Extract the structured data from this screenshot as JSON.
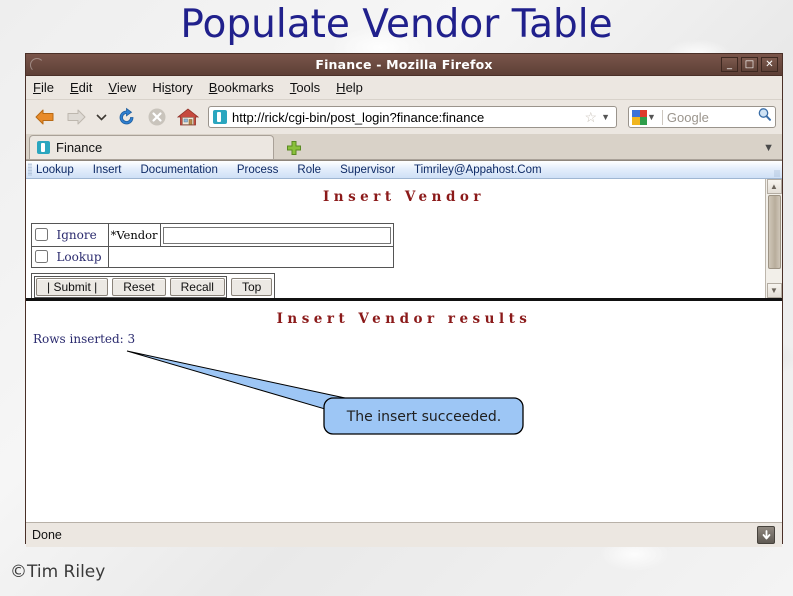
{
  "slide": {
    "title": "Populate Vendor Table",
    "footer": "©Tim Riley",
    "title_color": "#20208c"
  },
  "browser": {
    "window_title": "Finance - Mozilla Firefox",
    "window_controls": {
      "minimize": "_",
      "maximize": "□",
      "close": "✕"
    },
    "menus": [
      {
        "label": "File",
        "accel": "F"
      },
      {
        "label": "Edit",
        "accel": "E"
      },
      {
        "label": "View",
        "accel": "V"
      },
      {
        "label": "History",
        "accel": "s"
      },
      {
        "label": "Bookmarks",
        "accel": "B"
      },
      {
        "label": "Tools",
        "accel": "T"
      },
      {
        "label": "Help",
        "accel": "H"
      }
    ],
    "toolbar": {
      "back_icon": "back-arrow-icon",
      "forward_icon": "forward-arrow-icon",
      "history_dropdown_icon": "chevron-down-icon",
      "reload_icon": "reload-icon",
      "stop_icon": "stop-icon",
      "home_icon": "home-icon",
      "url": "http://rick/cgi-bin/post_login?finance:finance",
      "bookmark_star_icon": "star-icon",
      "url_dropdown_icon": "chevron-down-icon"
    },
    "search": {
      "engine_icon": "google-icon",
      "engine_dropdown_icon": "chevron-down-icon",
      "placeholder": "Google",
      "submit_icon": "magnifier-icon"
    },
    "tabs": [
      {
        "label": "Finance",
        "favicon": "page-favicon-icon",
        "active": true
      }
    ],
    "new_tab_icon": "plus-icon",
    "tab_list_icon": "chevron-down-icon",
    "status": {
      "text": "Done",
      "downloads_icon": "download-arrow-icon"
    }
  },
  "app": {
    "nav_items": [
      "Lookup",
      "Insert",
      "Documentation",
      "Process",
      "Role",
      "Supervisor",
      "Timriley@Appahost.Com"
    ],
    "form": {
      "heading": "Insert Vendor",
      "heading_color": "#8b1a1a",
      "checkboxes": [
        {
          "label": "Ignore",
          "checked": false
        },
        {
          "label": "Lookup",
          "checked": false
        }
      ],
      "field_label": "*Vendor",
      "field_value": "",
      "buttons": [
        "|  Submit  |",
        "Reset",
        "Recall",
        "Top"
      ]
    },
    "results": {
      "heading": "Insert Vendor results",
      "rows_inserted": "Rows inserted: 3"
    }
  },
  "callout": {
    "text": "The insert succeeded.",
    "fill": "#9dc6f5",
    "stroke": "#000000"
  },
  "scrollbar": {
    "up_icon": "scroll-up-icon",
    "down_icon": "scroll-down-icon",
    "thumb": "scroll-thumb"
  }
}
